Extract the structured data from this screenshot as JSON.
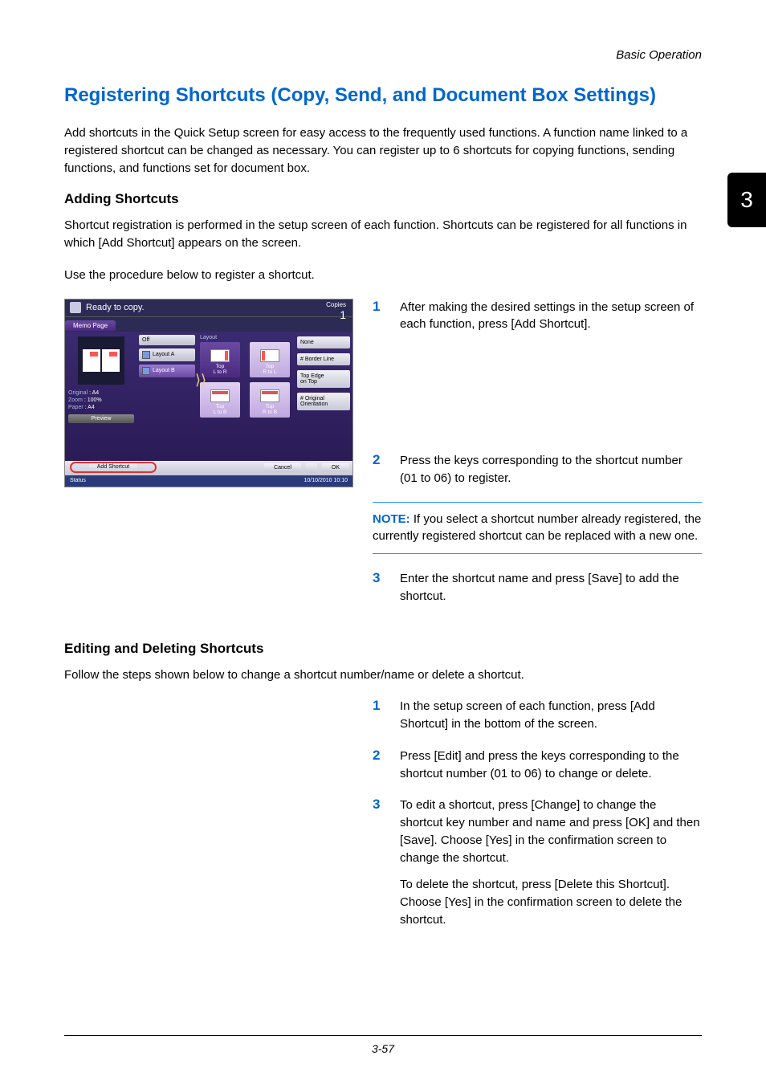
{
  "header": {
    "section": "Basic Operation"
  },
  "title": "Registering Shortcuts (Copy, Send, and Document Box Settings)",
  "intro": "Add shortcuts in the Quick Setup screen for easy access to the frequently used functions. A function name linked to a registered shortcut can be changed as necessary. You can register up to 6 shortcuts for copying functions, sending functions, and functions set for document box.",
  "adding": {
    "heading": "Adding Shortcuts",
    "p1": "Shortcut registration is performed in the setup screen of each function. Shortcuts can be registered for all functions in which [Add Shortcut] appears on the screen.",
    "p2": "Use the procedure below to register a shortcut.",
    "steps": {
      "s1_num": "1",
      "s1": "After making the desired settings in the setup screen of each function, press [Add Shortcut].",
      "s2_num": "2",
      "s2": "Press the keys corresponding to the shortcut number (01 to 06) to register.",
      "s3_num": "3",
      "s3": "Enter the shortcut name and press [Save] to add the shortcut."
    },
    "note_label": "NOTE:",
    "note_text": " If you select a shortcut number already registered, the currently registered shortcut can be replaced with a new one."
  },
  "editing": {
    "heading": "Editing and Deleting Shortcuts",
    "intro": "Follow the steps shown below to change a shortcut number/name or delete a shortcut.",
    "steps": {
      "s1_num": "1",
      "s1": "In the setup screen of each function, press [Add Shortcut] in the bottom of the screen.",
      "s2_num": "2",
      "s2": "Press [Edit] and press the keys corresponding to the shortcut number (01 to 06) to change or delete.",
      "s3_num": "3",
      "s3a": "To edit a shortcut, press [Change] to change the shortcut key number and name and press [OK] and then [Save]. Choose [Yes] in the confirmation screen to change the shortcut.",
      "s3b": "To delete the shortcut, press [Delete this Shortcut]. Choose [Yes] in the confirmation screen to delete the shortcut."
    }
  },
  "tab": "3",
  "footer": "3-57",
  "screenshot": {
    "title": "Ready to copy.",
    "copies_label": "Copies",
    "copies_value": "1",
    "tab_name": "Memo Page",
    "original_label": "Original",
    "original_value": ": A4",
    "zoom_label": "Zoom",
    "zoom_value": ": 100%",
    "paper_label": "Paper",
    "paper_value": ": A4",
    "preview_btn": "Preview",
    "opt_off": "Off",
    "opt_a": "Layout A",
    "opt_b": "Layout B",
    "layout_label": "Layout",
    "cells": {
      "tl1": "Top",
      "tl2": "L to R",
      "tr1": "Top",
      "tr2": "R to L",
      "bl1": "Top",
      "bl2": "L to B",
      "br1": "Top",
      "br2": "R to B"
    },
    "right": {
      "none": "None",
      "border": "# Border Line",
      "topedge1": "Top Edge",
      "topedge2": "on Top",
      "orient1": "# Original",
      "orient2": "Orientation"
    },
    "add_shortcut": "Add Shortcut",
    "cancel": "Cancel",
    "ok": "OK",
    "status": "Status",
    "timestamp": "10/10/2010 10:10"
  }
}
